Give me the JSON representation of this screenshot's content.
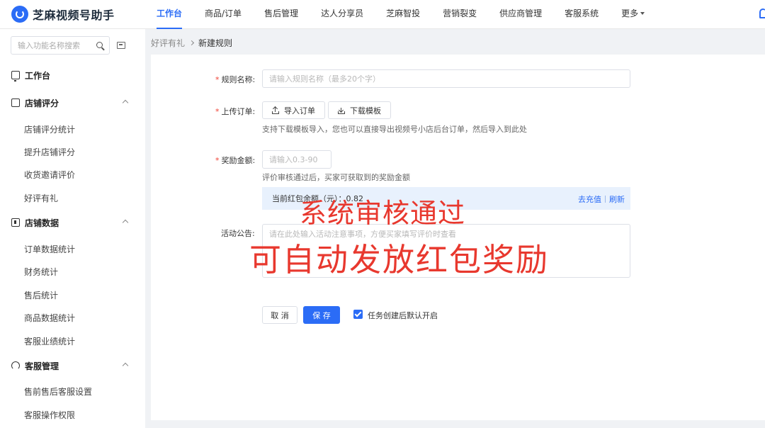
{
  "brand": {
    "name": "芝麻视频号助手"
  },
  "nav": {
    "items": [
      {
        "label": "工作台",
        "active": true
      },
      {
        "label": "商品/订单"
      },
      {
        "label": "售后管理"
      },
      {
        "label": "达人分享员"
      },
      {
        "label": "芝麻智投"
      },
      {
        "label": "营销裂变"
      },
      {
        "label": "供应商管理"
      },
      {
        "label": "客服系统"
      },
      {
        "label": "更多"
      }
    ]
  },
  "sidebar": {
    "search_placeholder": "输入功能名称搜索",
    "workbench": "工作台",
    "groups": [
      {
        "label": "店铺评分",
        "items": [
          "店铺评分统计",
          "提升店铺评分",
          "收货邀请评价",
          "好评有礼"
        ]
      },
      {
        "label": "店铺数据",
        "items": [
          "订单数据统计",
          "财务统计",
          "售后统计",
          "商品数据统计",
          "客服业绩统计"
        ]
      },
      {
        "label": "客服管理",
        "items": [
          "售前售后客服设置",
          "客服操作权限"
        ]
      }
    ]
  },
  "breadcrumb": {
    "parent": "好评有礼",
    "current": "新建规则"
  },
  "form": {
    "rule_name": {
      "label": "规则名称:",
      "placeholder": "请输入规则名称（最多20个字）"
    },
    "upload": {
      "label": "上传订单:",
      "import_label": "导入订单",
      "download_label": "下载模板",
      "hint": "支持下载模板导入，您也可以直接导出视频号小店后台订单，然后导入到此处"
    },
    "reward": {
      "label": "奖励金额:",
      "placeholder": "请输入0.3-90",
      "hint": "评价审核通过后，买家可获取到的奖励金额"
    },
    "balance": {
      "text": "当前红包余额（元）：0.82",
      "recharge": "去充值",
      "refresh": "刷新"
    },
    "notice": {
      "label": "活动公告:",
      "placeholder": "请在此处输入活动注意事项，方便买家填写评价时查看"
    },
    "cancel_label": "取 消",
    "save_label": "保 存",
    "auto_open_label": "任务创建后默认开启"
  },
  "overlay": {
    "line1": "系统审核通过",
    "line2": "可自动发放红包奖励"
  },
  "colors": {
    "accent": "#2b6cf6",
    "overlay": "#e8382e",
    "required": "#f04134"
  }
}
